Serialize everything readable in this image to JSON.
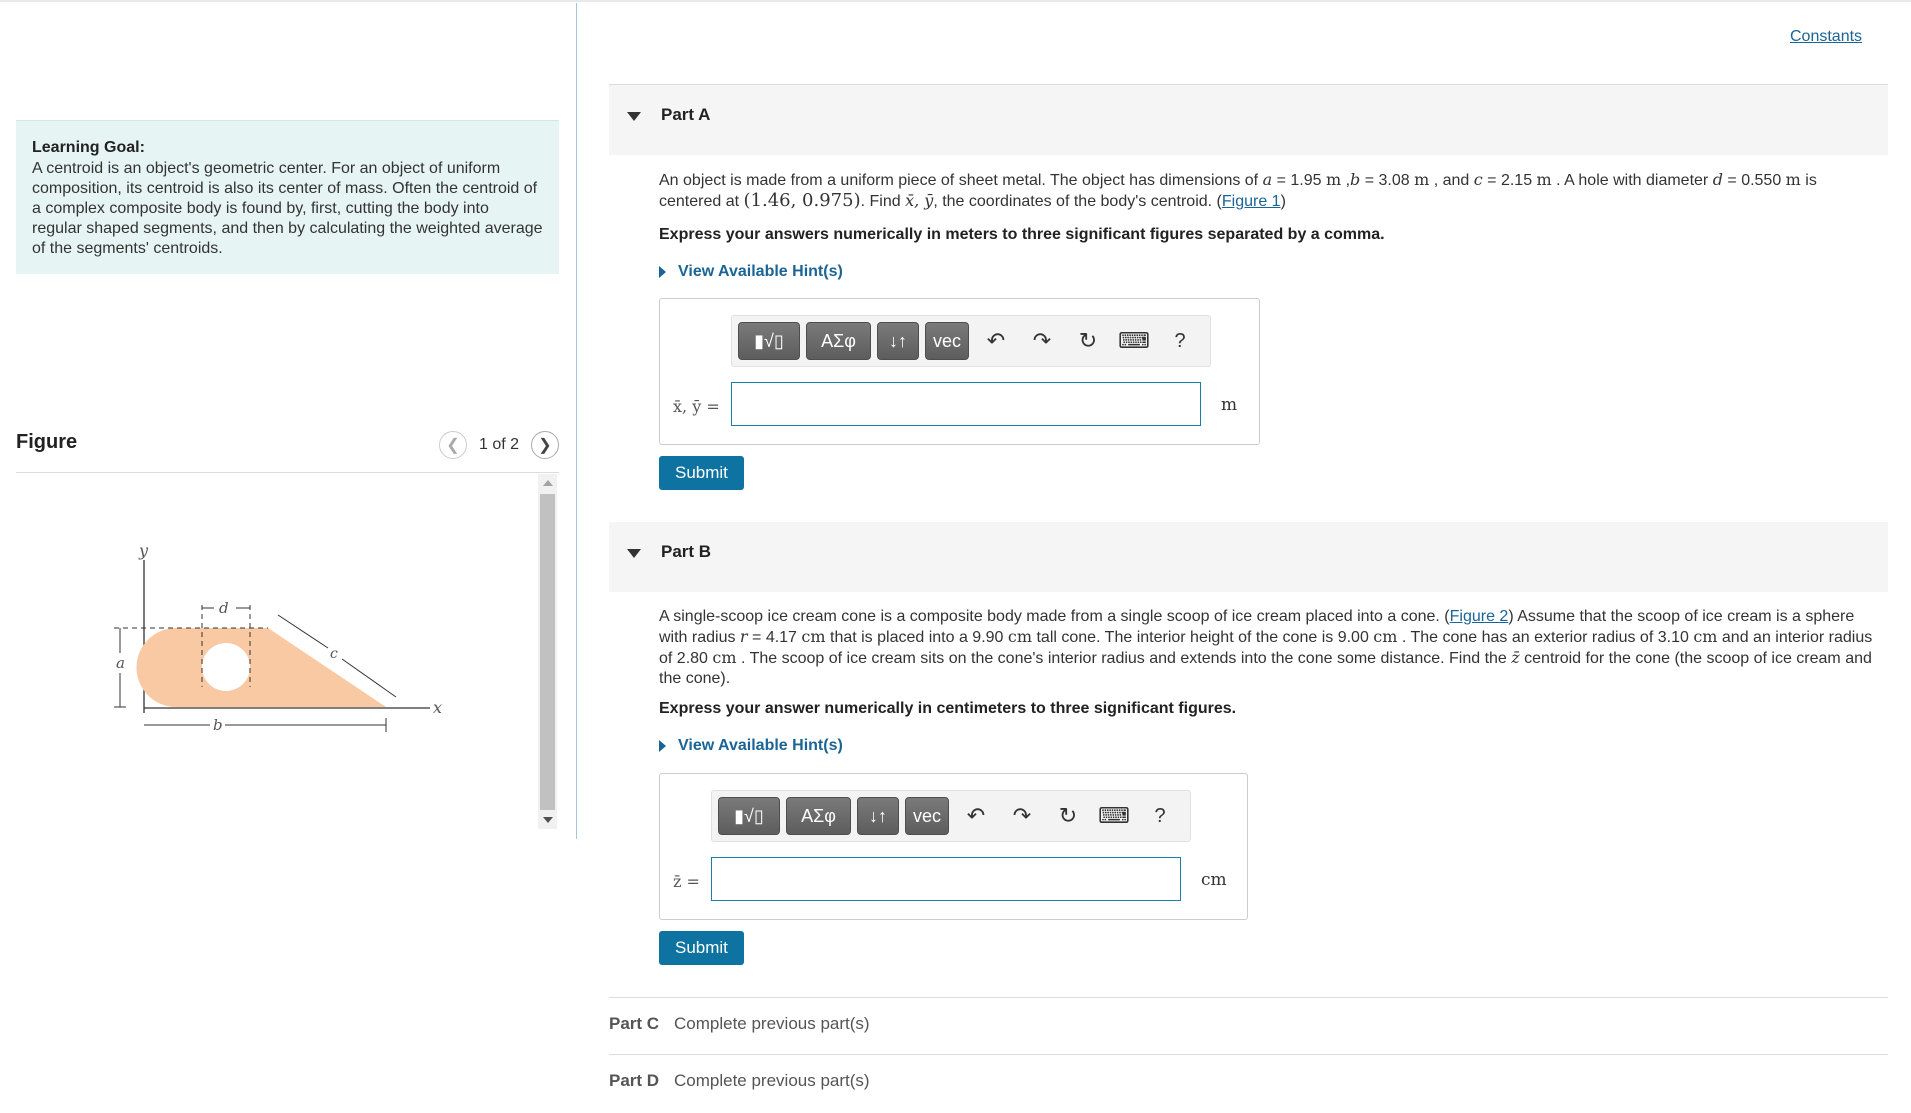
{
  "header": {
    "constants_link": "Constants"
  },
  "learning_goal": {
    "title": "Learning Goal:",
    "text": "A centroid is an object's geometric center. For an object of uniform composition, its centroid is also its center of mass. Often the centroid of a complex composite body is found by, first, cutting the body into regular shaped segments, and then by calculating the weighted average of the segments' centroids."
  },
  "figure": {
    "title": "Figure",
    "pager": "1 of 2",
    "labels": {
      "y": "y",
      "x": "x",
      "a": "a",
      "b": "b",
      "c": "c",
      "d": "d"
    },
    "fill_color": "#f9c9a4"
  },
  "partA": {
    "label": "Part A",
    "q_pre": "An object is made from a uniform piece of sheet metal. The object has dimensions of ",
    "a_sym": "a",
    "a_eq": " = 1.95 ",
    "a_unit": "m",
    "b_sym": "b",
    "b_eq": " = 3.08 ",
    "b_unit": "m",
    "c_mid": " , and ",
    "c_sym": "c",
    "c_eq": " = 2.15 ",
    "c_unit": "m",
    "d_mid": " . A hole with diameter ",
    "d_sym": "d",
    "d_eq": " = 0.550 ",
    "d_unit": "m",
    "d_post": " is",
    "q2_pre": "centered at ",
    "coords": "(1.46, 0.975)",
    "q2_mid": ". Find ",
    "xy_sym": "x̄, ȳ",
    "q2_post": ", the coordinates of the body's centroid. (",
    "figure_link": "Figure 1",
    "q2_end": ")",
    "instruction": "Express your answers numerically in meters to three significant figures separated by a comma.",
    "hint": "View Available Hint(s)",
    "input_label": "x̄, ȳ =",
    "input_value": "",
    "unit": "m",
    "submit": "Submit"
  },
  "toolbar": {
    "templates": "▮√▯",
    "greek": "ΑΣφ",
    "arrows": "↓↑",
    "vec": "vec",
    "undo": "↶",
    "redo": "↷",
    "reset": "↻",
    "keyboard": "⌨",
    "help": "?"
  },
  "partB": {
    "label": "Part B",
    "p1": "A single-scoop ice cream cone is a composite body made from a single scoop of ice cream placed into a cone. (",
    "figure_link": "Figure 2",
    "p2": ") Assume that the scoop of ice cream is a sphere with radius ",
    "r_sym": "r",
    "r_eq": " = 4.17 ",
    "cm1": "cm",
    "p3": " that is placed into a 9.90 ",
    "cm2": "cm",
    "p4": " tall cone. The interior height of the cone is 9.00 ",
    "cm3": "cm",
    "p5": " . The cone has an exterior radius of 3.10 ",
    "cm4": "cm",
    "p6": " and an interior radius of 2.80 ",
    "cm5": "cm",
    "p7": " . The scoop of ice cream sits on the cone's interior radius and extends into the cone some distance. Find the ",
    "z_sym": "z̄",
    "p8": " centroid for the cone (the scoop of ice cream and the cone).",
    "instruction": "Express your answer numerically in centimeters to three significant figures.",
    "hint": "View Available Hint(s)",
    "input_label": "z̄ =",
    "input_value": "",
    "unit": "cm",
    "submit": "Submit"
  },
  "partC": {
    "label": "Part C",
    "status": "Complete previous part(s)"
  },
  "partD": {
    "label": "Part D",
    "status": "Complete previous part(s)"
  }
}
